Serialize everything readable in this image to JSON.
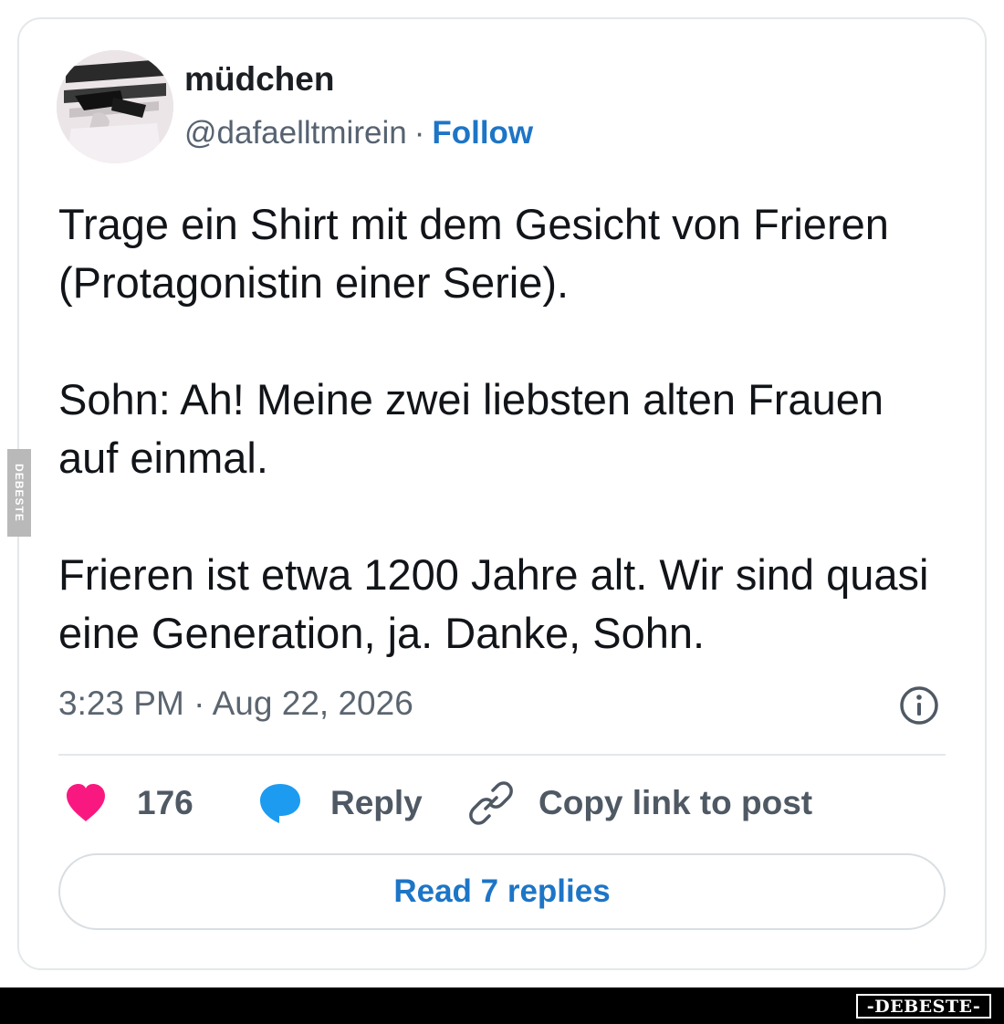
{
  "author": {
    "display_name": "müdchen",
    "handle": "@dafaelltmirein",
    "separator": "·",
    "follow_label": "Follow",
    "avatar_icon": "profile-photo"
  },
  "tweet": {
    "paragraphs": [
      "Trage ein Shirt mit dem Gesicht von Frieren (Protagonistin einer Serie).",
      "Sohn: Ah! Meine zwei liebsten alten Frauen auf einmal.",
      "Frieren ist etwa 1200 Jahre alt. Wir sind quasi eine Generation, ja. Danke, Sohn."
    ],
    "timestamp": "3:23 PM · Aug 22, 2026"
  },
  "actions": {
    "like_count": "176",
    "reply_label": "Reply",
    "copy_link_label": "Copy link to post",
    "read_replies_label": "Read 7 replies"
  },
  "icons": {
    "like": "heart-icon",
    "reply": "speech-bubble-icon",
    "copy": "link-icon",
    "info": "info-icon"
  },
  "watermark": {
    "side_text": "DEBESTE",
    "footer_logo": "-DEBESTE-"
  },
  "colors": {
    "link_blue": "#1d75c6",
    "heart_pink": "#f91880",
    "reply_blue": "#1d9bf0",
    "muted_text": "#566270",
    "border": "#e4e8ea"
  }
}
